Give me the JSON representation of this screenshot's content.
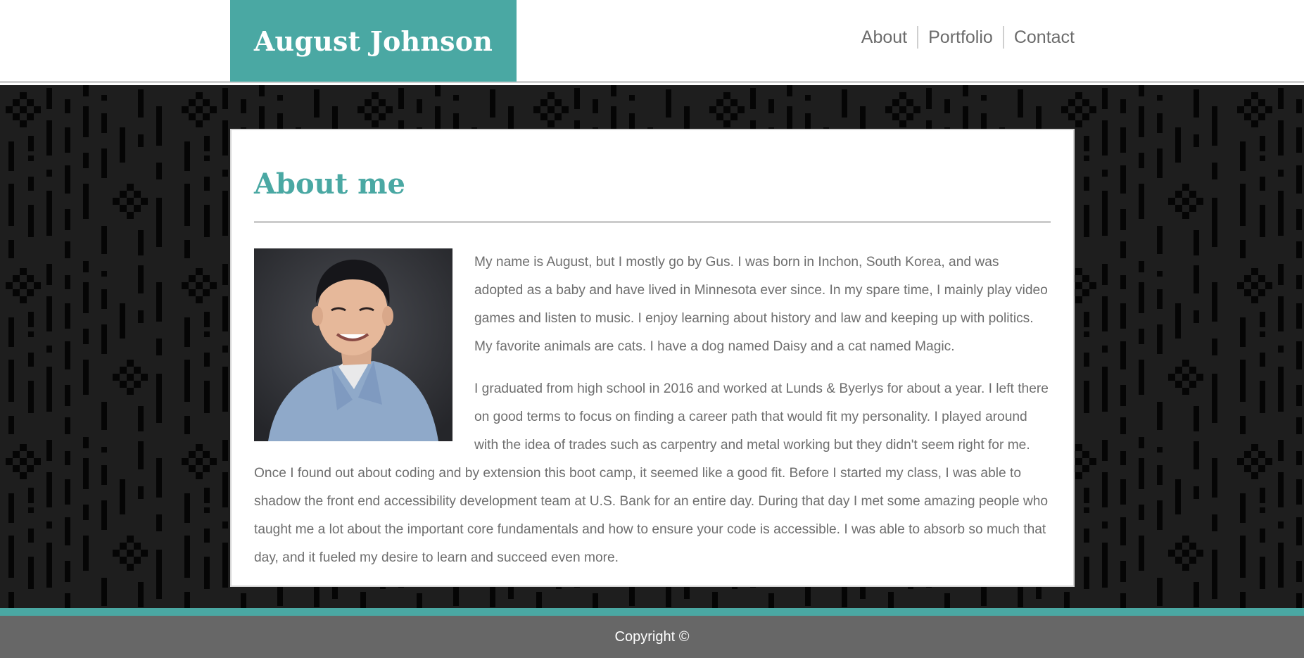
{
  "header": {
    "brand": "August Johnson",
    "nav": [
      {
        "label": "About"
      },
      {
        "label": "Portfolio"
      },
      {
        "label": "Contact"
      }
    ]
  },
  "main": {
    "heading": "About me",
    "photo_alt": "Portrait of August Johnson",
    "paragraphs": [
      "My name is August, but I mostly go by Gus. I was born in Inchon, South Korea, and was adopted as a baby and have lived in Minnesota ever since. In my spare time, I mainly play video games and listen to music. I enjoy learning about history and law and keeping up with politics. My favorite animals are cats. I have a dog named Daisy and a cat named Magic.",
      "I graduated from high school in 2016 and worked at Lunds & Byerlys for about a year. I left there on good terms to focus on finding a career path that would fit my personality. I played around with the idea of trades such as carpentry and metal working but they didn't seem right for me. Once I found out about coding and by extension this boot camp, it seemed like a good fit. Before I started my class, I was able to shadow the front end accessibility development team at U.S. Bank for an entire day. During that day I met some amazing people who taught me a lot about the important core fundamentals and how to ensure your code is accessible. I was able to absorb so much that day, and it fueled my desire to learn and succeed even more."
    ]
  },
  "footer": {
    "copyright": "Copyright ©"
  },
  "colors": {
    "accent": "#4aa8a3",
    "footer_bg": "#676767",
    "pattern_bg": "#1e1e1e",
    "text": "#6e6e6e"
  }
}
